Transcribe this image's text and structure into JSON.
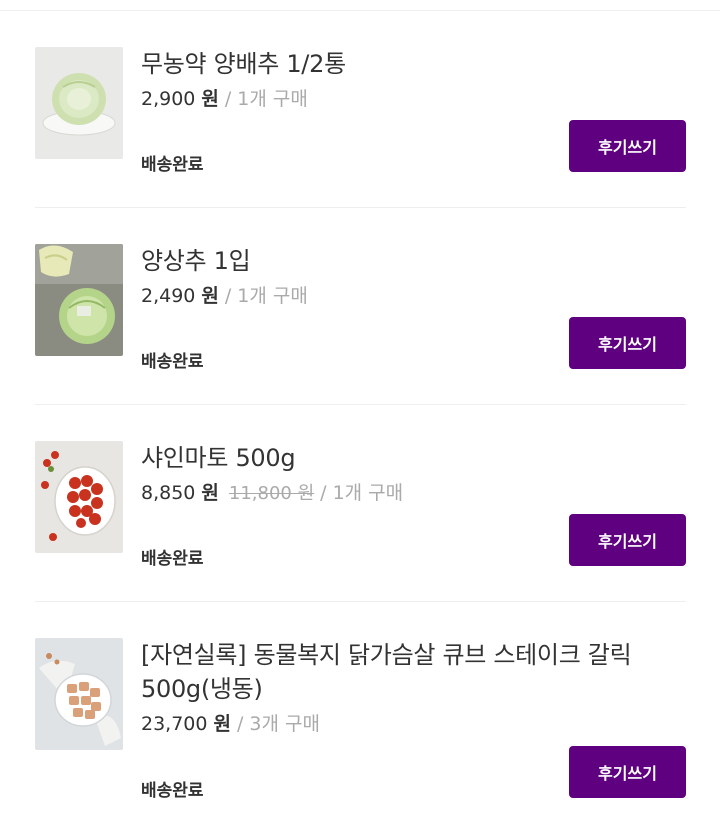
{
  "orders": [
    {
      "name": "무농약 양배추 1/2통",
      "price": "2,900",
      "currency": "원",
      "original_price": "",
      "quantity": "1개 구매",
      "status": "배송완료",
      "button": "후기쓰기",
      "image": "cabbage-image"
    },
    {
      "name": "양상추 1입",
      "price": "2,490",
      "currency": "원",
      "original_price": "",
      "quantity": "1개 구매",
      "status": "배송완료",
      "button": "후기쓰기",
      "image": "lettuce-image"
    },
    {
      "name": "샤인마토 500g",
      "price": "8,850",
      "currency": "원",
      "original_price": "11,800 원",
      "quantity": "1개 구매",
      "status": "배송완료",
      "button": "후기쓰기",
      "image": "tomato-image"
    },
    {
      "name": "[자연실록] 동물복지 닭가슴살 큐브 스테이크 갈릭 500g(냉동)",
      "price": "23,700",
      "currency": "원",
      "original_price": "",
      "quantity": "3개 구매",
      "status": "배송완료",
      "button": "후기쓰기",
      "image": "chicken-cube-image"
    }
  ],
  "colors": {
    "accent": "#5f0080",
    "muted": "#aaaaaa",
    "text": "#333333"
  }
}
